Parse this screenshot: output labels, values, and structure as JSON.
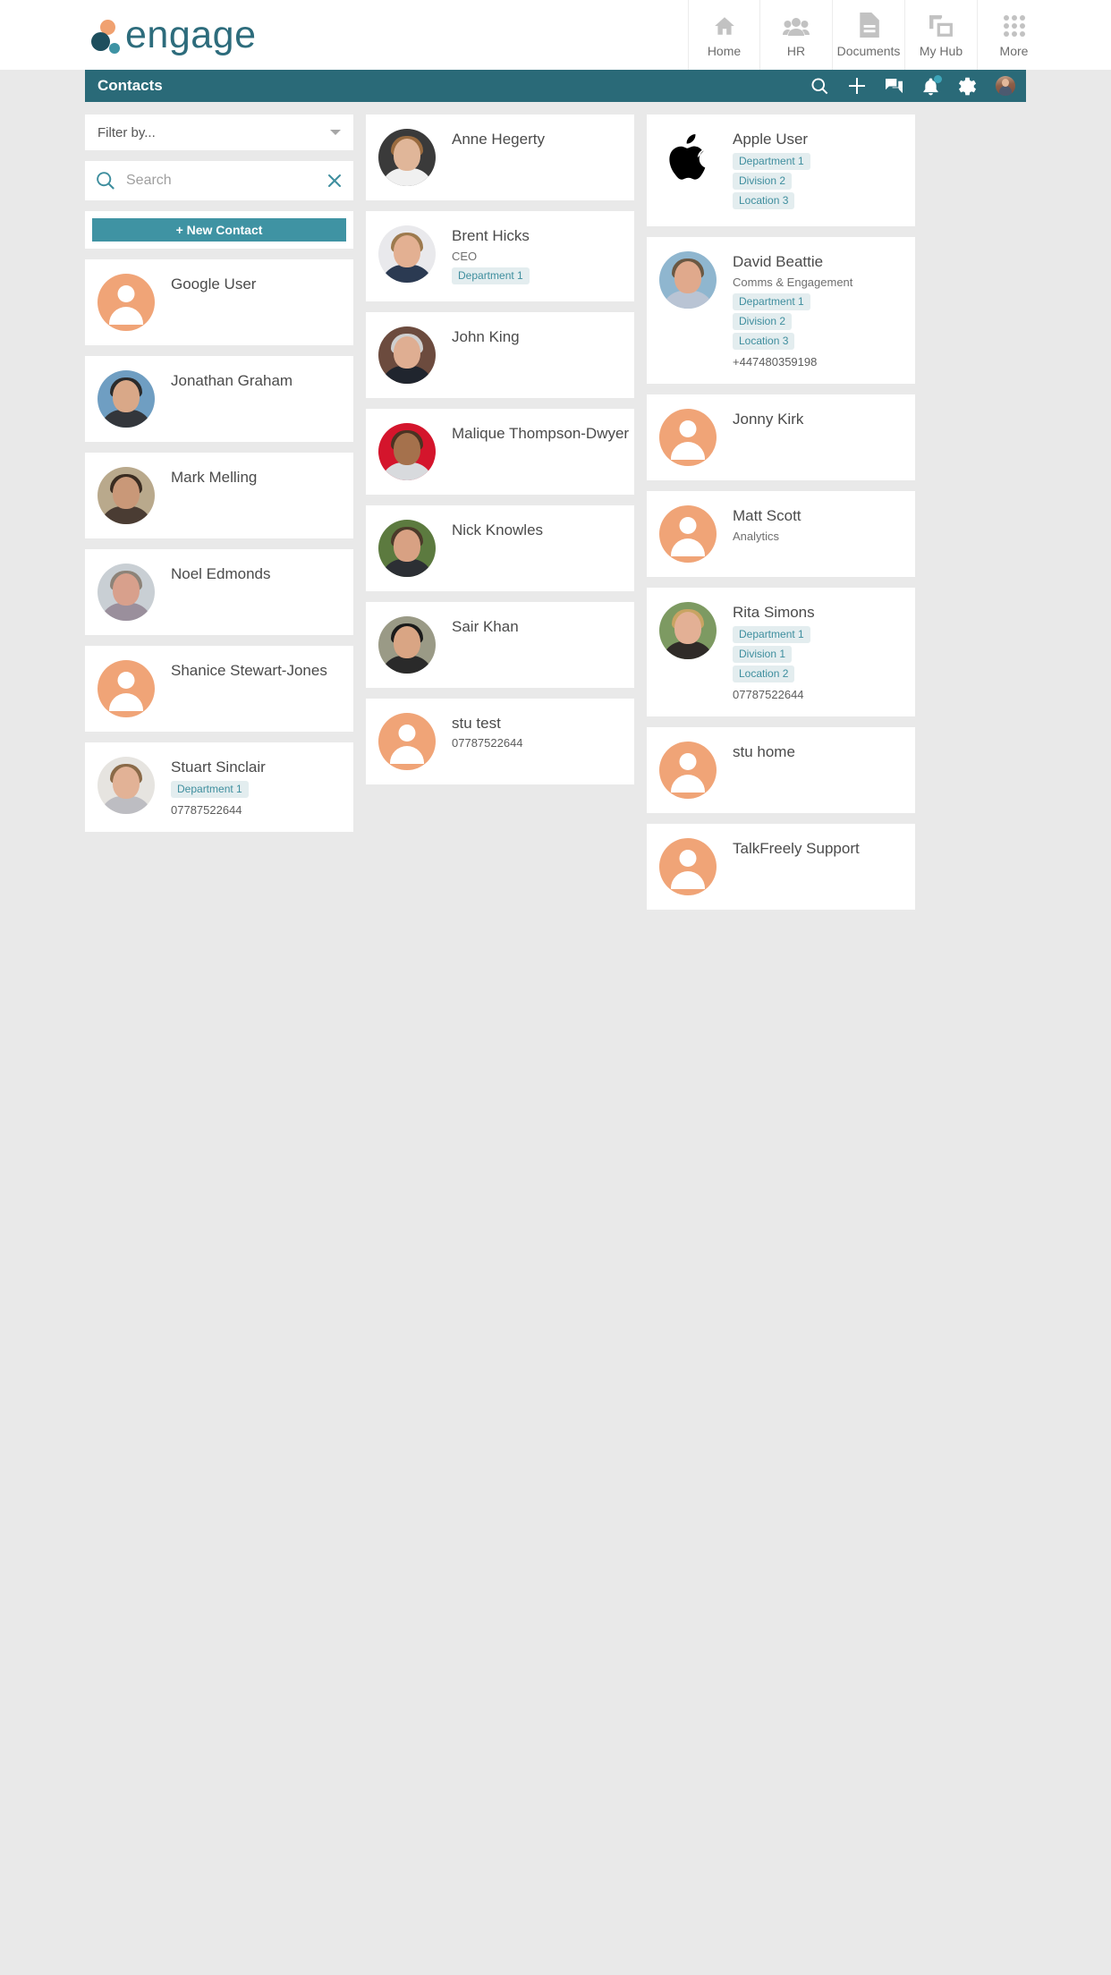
{
  "brand": {
    "name": "engage",
    "dot_orange": "#f0a170",
    "dot_dark": "#1e4f5e",
    "dot_teal": "#3e93a4"
  },
  "topnav": {
    "items": [
      {
        "label": "Home",
        "icon": "home-icon"
      },
      {
        "label": "HR",
        "icon": "people-icon"
      },
      {
        "label": "Documents",
        "icon": "document-icon"
      },
      {
        "label": "My Hub",
        "icon": "layers-icon"
      },
      {
        "label": "More",
        "icon": "grid-icon"
      }
    ]
  },
  "toolbar": {
    "title": "Contacts",
    "background": "#2a6a78",
    "icons": [
      {
        "name": "search-icon"
      },
      {
        "name": "plus-icon"
      },
      {
        "name": "chat-icon"
      },
      {
        "name": "bell-icon",
        "badge": true
      },
      {
        "name": "gear-icon"
      },
      {
        "name": "user-avatar"
      }
    ]
  },
  "controls": {
    "filter_label": "Filter by...",
    "search_placeholder": "Search",
    "search_value": "",
    "new_contact_label": "+ New Contact",
    "accent": "#3f93a3"
  },
  "columns": [
    {
      "id": "column-1",
      "cards": [
        {
          "name": "Google User",
          "subtitle": "",
          "tags": [],
          "phone": "",
          "avatar": "placeholder"
        },
        {
          "name": "Jonathan Graham",
          "subtitle": "",
          "tags": [],
          "phone": "",
          "avatar": "photo-jonathan"
        },
        {
          "name": "Mark Melling",
          "subtitle": "",
          "tags": [],
          "phone": "",
          "avatar": "photo-mark"
        },
        {
          "name": "Noel Edmonds",
          "subtitle": "",
          "tags": [],
          "phone": "",
          "avatar": "photo-noel"
        },
        {
          "name": "Shanice Stewart-Jones",
          "subtitle": "",
          "tags": [],
          "phone": "",
          "avatar": "placeholder"
        },
        {
          "name": "Stuart Sinclair",
          "subtitle": "",
          "tags": [
            "Department 1"
          ],
          "phone": "07787522644",
          "avatar": "photo-stuart"
        }
      ]
    },
    {
      "id": "column-2",
      "cards": [
        {
          "name": "Anne Hegerty",
          "subtitle": "",
          "tags": [],
          "phone": "",
          "avatar": "photo-anne"
        },
        {
          "name": "Brent Hicks",
          "subtitle": "CEO",
          "tags": [
            "Department 1"
          ],
          "phone": "",
          "avatar": "photo-brent"
        },
        {
          "name": "John King",
          "subtitle": "",
          "tags": [],
          "phone": "",
          "avatar": "photo-john"
        },
        {
          "name": "Malique Thompson-Dwyer",
          "subtitle": "",
          "tags": [],
          "phone": "",
          "avatar": "photo-malique"
        },
        {
          "name": "Nick Knowles",
          "subtitle": "",
          "tags": [],
          "phone": "",
          "avatar": "photo-nick"
        },
        {
          "name": "Sair Khan",
          "subtitle": "",
          "tags": [],
          "phone": "",
          "avatar": "photo-sair"
        },
        {
          "name": "stu test",
          "subtitle": "",
          "tags": [],
          "phone": "07787522644",
          "avatar": "placeholder"
        }
      ]
    },
    {
      "id": "column-3",
      "cards": [
        {
          "name": "Apple User",
          "subtitle": "",
          "tags": [
            "Department 1",
            "Division 2",
            "Location 3"
          ],
          "phone": "",
          "avatar": "apple"
        },
        {
          "name": "David Beattie",
          "subtitle": "Comms & Engagement",
          "tags": [
            "Department 1",
            "Division 2",
            "Location 3"
          ],
          "phone": "+447480359198",
          "avatar": "photo-david"
        },
        {
          "name": "Jonny Kirk",
          "subtitle": "",
          "tags": [],
          "phone": "",
          "avatar": "placeholder"
        },
        {
          "name": "Matt Scott",
          "subtitle": "Analytics",
          "tags": [],
          "phone": "",
          "avatar": "placeholder"
        },
        {
          "name": "Rita Simons",
          "subtitle": "",
          "tags": [
            "Department 1",
            "Division 1",
            "Location 2"
          ],
          "phone": "07787522644",
          "avatar": "photo-rita"
        },
        {
          "name": "stu home",
          "subtitle": "",
          "tags": [],
          "phone": "",
          "avatar": "placeholder"
        },
        {
          "name": "TalkFreely Support",
          "subtitle": "",
          "tags": [],
          "phone": "",
          "avatar": "placeholder"
        }
      ]
    }
  ]
}
